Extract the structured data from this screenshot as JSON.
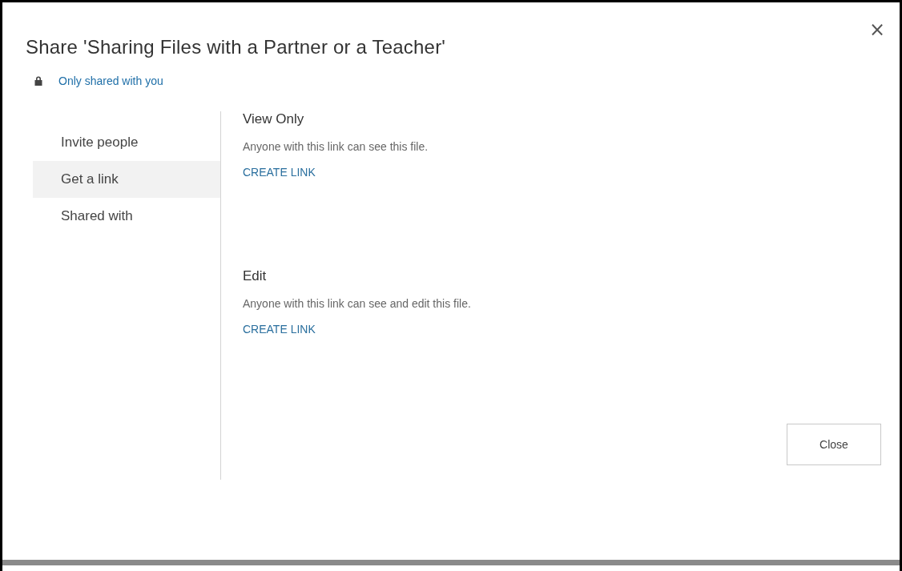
{
  "dialog": {
    "title": "Share 'Sharing Files with a Partner or a Teacher'",
    "close_icon": "×",
    "permission_link": "Only shared with you"
  },
  "sidebar": {
    "items": [
      {
        "label": "Invite people",
        "selected": false
      },
      {
        "label": "Get a link",
        "selected": true
      },
      {
        "label": "Shared with",
        "selected": false
      }
    ]
  },
  "sections": [
    {
      "heading": "View Only",
      "description": "Anyone with this link can see this file.",
      "action": "CREATE LINK"
    },
    {
      "heading": "Edit",
      "description": "Anyone with this link can see and edit this file.",
      "action": "CREATE LINK"
    }
  ],
  "buttons": [
    "Close"
  ]
}
